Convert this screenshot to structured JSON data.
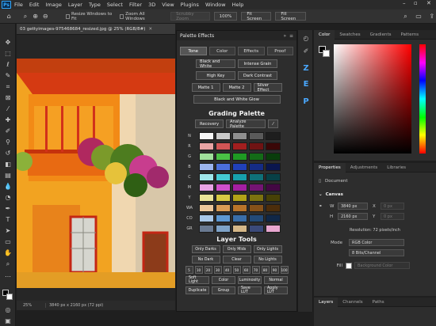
{
  "menubar": {
    "logo": "Ps",
    "items": [
      "File",
      "Edit",
      "Image",
      "Layer",
      "Type",
      "Select",
      "Filter",
      "3D",
      "View",
      "Plugins",
      "Window",
      "Help"
    ]
  },
  "optbar": {
    "resize_windows": "Resize Windows to Fit",
    "zoom_all": "Zoom All Windows",
    "scrubby_zoom": "Scrubby Zoom",
    "pct100": "100%",
    "fit_screen": "Fit Screen",
    "fill_screen": "Fill Screen"
  },
  "document": {
    "tab_title": "03 gettyimages-975468684_resized.jpg @ 25% (RGB/8#)",
    "zoom": "25%",
    "info": "3840 px x 2160 px (72 ppi)"
  },
  "palette_effects": {
    "title": "Palette Effects",
    "tabs": [
      "Tone",
      "Color",
      "Effects",
      "Proof"
    ],
    "tone_buttons": [
      [
        "Black and White",
        "Intense Grain"
      ],
      [
        "High Key",
        "Dark Contrast"
      ],
      [
        "Matte 1",
        "Matte 2",
        "Silver Effect"
      ],
      [
        "Black and White Glow"
      ]
    ],
    "grading_title": "Grading Palette",
    "recovery": "Recovery",
    "analyze": "Analyze Palette",
    "rows": [
      {
        "label": "N",
        "colors": [
          "#f7f7f7",
          "#c9c9c9",
          "#8f8f8f",
          "#5a5a5a",
          "#1e1e1e"
        ]
      },
      {
        "label": "R",
        "colors": [
          "#e9a3a3",
          "#d15555",
          "#a21f1f",
          "#6f1313",
          "#3a0707"
        ]
      },
      {
        "label": "G",
        "colors": [
          "#9fe09a",
          "#49c145",
          "#1f9a23",
          "#136b17",
          "#093d0b"
        ]
      },
      {
        "label": "B",
        "colors": [
          "#9bb4ee",
          "#4b6fdb",
          "#2141b8",
          "#152c85",
          "#0a164e"
        ]
      },
      {
        "label": "C",
        "colors": [
          "#9fe6ea",
          "#44c9d2",
          "#17a0ab",
          "#0f7078",
          "#074046"
        ]
      },
      {
        "label": "M",
        "colors": [
          "#e8a3e6",
          "#cf4fcb",
          "#a41fa1",
          "#741473",
          "#430843"
        ]
      },
      {
        "label": "Y",
        "colors": [
          "#eae397",
          "#d7c943",
          "#b1a218",
          "#7c720f",
          "#474106"
        ]
      },
      {
        "label": "WA",
        "colors": [
          "#ecc79b",
          "#d99c55",
          "#b8742a",
          "#855119",
          "#4c2d0b"
        ]
      },
      {
        "label": "CO",
        "colors": [
          "#a8c7e8",
          "#5d98d3",
          "#3a6ea8",
          "#234a78",
          "#102747"
        ]
      },
      {
        "label": "GR",
        "colors": [
          "#6a7a92",
          "#7fa3c8",
          "#d6b888",
          "#3b4a7a",
          "#e8a7d0"
        ]
      }
    ],
    "layer_tools_title": "Layer Tools",
    "layer_buttons": [
      [
        "Only Darks",
        "Only Mids",
        "Only Lights"
      ],
      [
        "No Dark",
        "Clear",
        "No Lights"
      ]
    ],
    "numbers": [
      "5",
      "10",
      "20",
      "30",
      "40",
      "50",
      "60",
      "70",
      "80",
      "90",
      "100"
    ],
    "blend_buttons": [
      "Soft Light",
      "Color",
      "Luminosity",
      "Normal"
    ],
    "bottom_buttons": [
      "Duplicate",
      "Group",
      "Save LUT",
      "Apply LUT"
    ]
  },
  "strip": {
    "letters": [
      "Z",
      "E",
      "P"
    ]
  },
  "color_panel": {
    "tabs": [
      "Color",
      "Swatches",
      "Gradients",
      "Patterns"
    ]
  },
  "properties": {
    "tabs": [
      "Properties",
      "Adjustments",
      "Libraries"
    ],
    "document_label": "Document",
    "canvas_label": "Canvas",
    "w_label": "W",
    "w_value": "3840 px",
    "h_label": "H",
    "h_value": "2160 px",
    "x_label": "X",
    "x_value": "0 px",
    "y_label": "Y",
    "y_value": "0 px",
    "resolution": "Resolution: 72 pixels/inch",
    "mode_label": "Mode",
    "mode_value": "RGB Color",
    "bits_value": "8 Bits/Channel",
    "fill_label": "Fill",
    "fill_value": "Background Color"
  },
  "layers": {
    "tabs": [
      "Layers",
      "Channels",
      "Paths"
    ]
  }
}
